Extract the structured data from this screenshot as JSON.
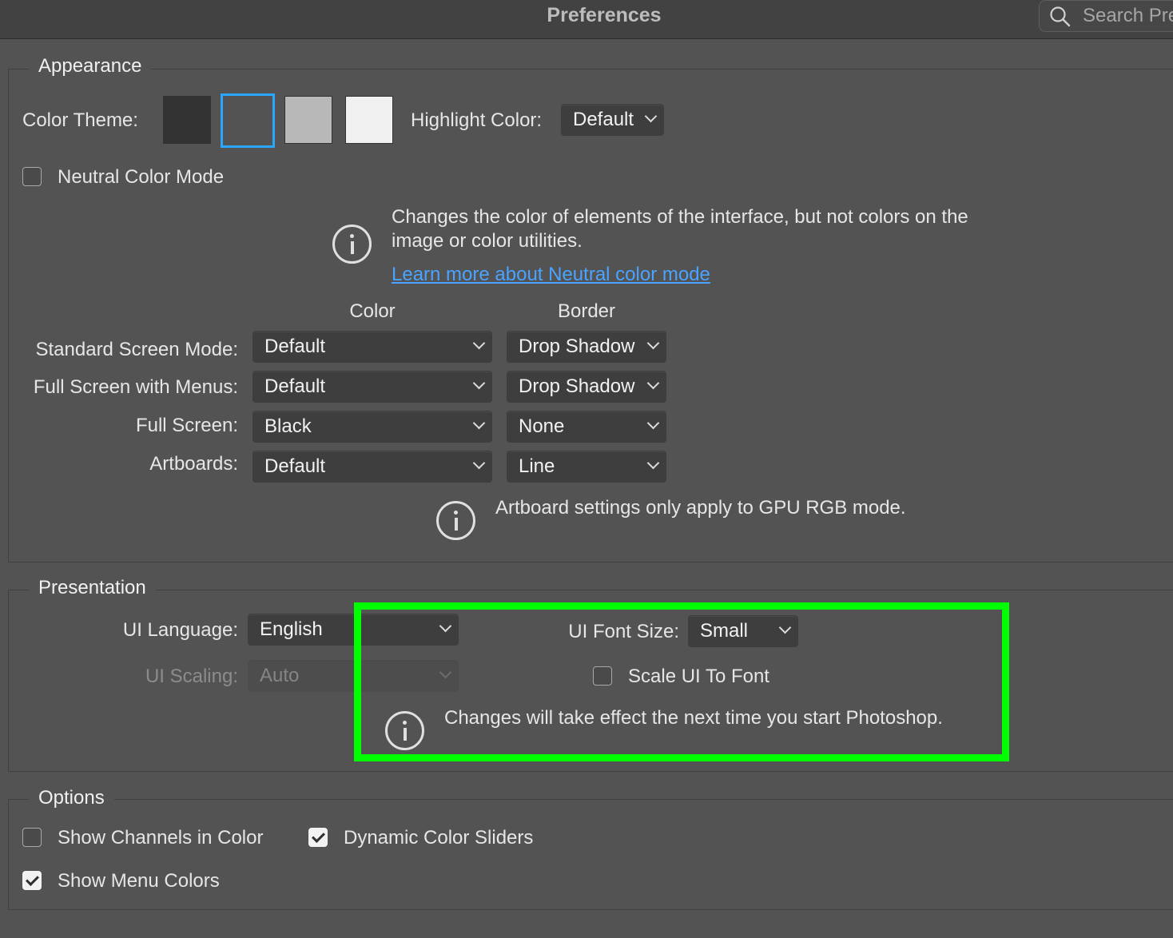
{
  "window": {
    "title": "Preferences",
    "search_placeholder": "Search Pre"
  },
  "appearance": {
    "legend": "Appearance",
    "color_theme_label": "Color Theme:",
    "theme_swatches": [
      {
        "name": "darkest",
        "color": "#323232"
      },
      {
        "name": "dark",
        "color": "#535353",
        "selected": true
      },
      {
        "name": "medium",
        "color": "#b8b8b8"
      },
      {
        "name": "light",
        "color": "#f0f0f0"
      }
    ],
    "highlight_color_label": "Highlight Color:",
    "highlight_color_value": "Default",
    "neutral_color_mode_label": "Neutral Color Mode",
    "neutral_color_mode_checked": false,
    "neutral_info_text_line1": "Changes the color of elements of the interface, but not colors on the",
    "neutral_info_text_line2": "image or color utilities.",
    "neutral_learn_more": "Learn more about Neutral color mode",
    "col_color": "Color",
    "col_border": "Border",
    "rows": [
      {
        "label": "Standard Screen Mode:",
        "color": "Default",
        "border": "Drop Shadow"
      },
      {
        "label": "Full Screen with Menus:",
        "color": "Default",
        "border": "Drop Shadow"
      },
      {
        "label": "Full Screen:",
        "color": "Black",
        "border": "None"
      },
      {
        "label": "Artboards:",
        "color": "Default",
        "border": "Line"
      }
    ],
    "artboard_info": "Artboard settings only apply to GPU RGB mode."
  },
  "presentation": {
    "legend": "Presentation",
    "ui_language_label": "UI Language:",
    "ui_language_value": "English",
    "ui_scaling_label": "UI Scaling:",
    "ui_scaling_value": "Auto",
    "ui_font_size_label": "UI Font Size:",
    "ui_font_size_value": "Small",
    "scale_ui_to_font_label": "Scale UI To Font",
    "scale_ui_to_font_checked": false,
    "restart_info": "Changes will take effect the next time you start Photoshop.",
    "highlight_box_color": "#00ff00"
  },
  "options": {
    "legend": "Options",
    "show_channels_in_color": "Show Channels in Color",
    "show_channels_in_color_checked": false,
    "dynamic_color_sliders": "Dynamic Color Sliders",
    "dynamic_color_sliders_checked": true,
    "show_menu_colors": "Show Menu Colors",
    "show_menu_colors_checked": true
  },
  "colors": {
    "accent": "#2aa6ff",
    "link": "#4aa3ff",
    "panel": "#535353"
  }
}
